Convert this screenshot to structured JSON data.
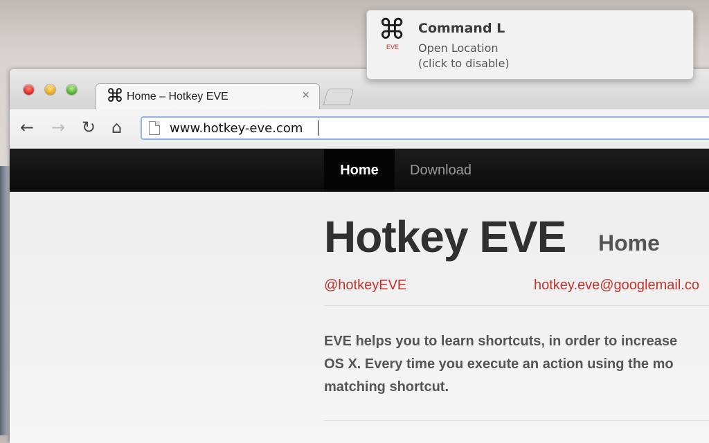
{
  "notification": {
    "icon": "command-key-icon",
    "icon_label": "EVE",
    "title": "Command L",
    "line1": "Open Location",
    "line2": "(click to disable)"
  },
  "browser": {
    "tab": {
      "icon": "command-key-icon",
      "title": "Home – Hotkey EVE",
      "close": "×"
    },
    "toolbar": {
      "back": "←",
      "forward": "→",
      "reload": "↻",
      "home": "⌂"
    },
    "address_bar": {
      "value": "www.hotkey-eve.com"
    }
  },
  "site": {
    "nav": [
      {
        "label": "Home",
        "active": true
      },
      {
        "label": "Download",
        "active": false
      }
    ],
    "title": "Hotkey EVE",
    "subtitle": "Home",
    "twitter": "@hotkeyEVE",
    "email": "hotkey.eve@googlemail.co",
    "intro_lines": [
      "EVE helps you to learn shortcuts, in order to increase",
      "OS X. Every time you execute an action using the mo",
      "matching shortcut."
    ]
  },
  "colors": {
    "link": "#c7312a",
    "navbar": "#111111",
    "address_focus": "#8fb4e6"
  }
}
